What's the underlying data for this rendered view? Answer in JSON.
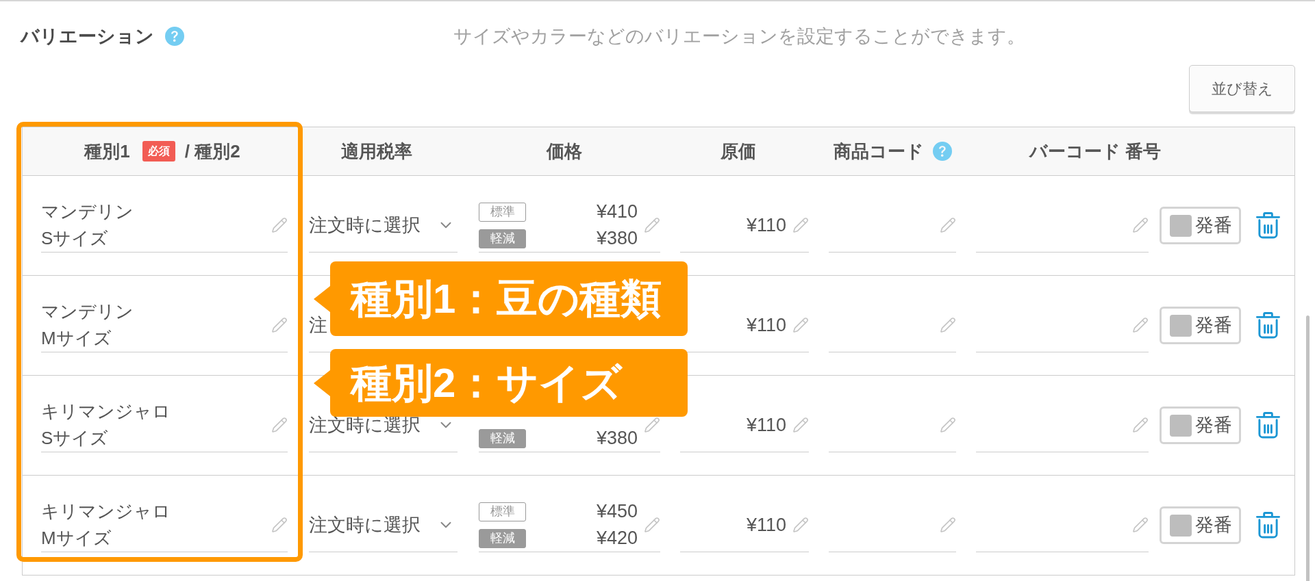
{
  "section": {
    "title": "バリエーション",
    "help": true,
    "description": "サイズやカラーなどのバリエーションを設定することができます。"
  },
  "sort_button": {
    "label": "並び替え"
  },
  "table": {
    "columns": [
      {
        "label": "種別1",
        "badge": "必須",
        "suffix": "/ 種別2"
      },
      {
        "label": "適用税率"
      },
      {
        "label": "価格"
      },
      {
        "label": "原価"
      },
      {
        "label": "商品コード",
        "help": true
      },
      {
        "label": "バーコード 番号"
      }
    ],
    "rows": [
      {
        "type1": "マンデリン",
        "type2": "Sサイズ",
        "tax": {
          "value": "注文時に選択",
          "expandable": true
        },
        "prices": [
          {
            "kind": "standard",
            "label": "標準",
            "price": "¥410"
          },
          {
            "kind": "reduced",
            "label": "軽減",
            "price": "¥380"
          }
        ],
        "cost": "¥110",
        "issue_button": {
          "label": "発番",
          "checked": false
        }
      },
      {
        "type1": "マンデリン",
        "type2": "Mサイズ",
        "tax": {
          "value": "注"
        },
        "cost": "¥110",
        "issue_button": {
          "label": "発番",
          "checked": false
        }
      },
      {
        "type1": "キリマンジャロ",
        "type2": "Sサイズ",
        "tax": {
          "value": "注文時に選択",
          "expandable": true
        },
        "prices": [
          {
            "kind": "reduced",
            "label": "軽減",
            "price": "¥380"
          }
        ],
        "cost": "¥110",
        "issue_button": {
          "label": "発番",
          "checked": false
        }
      },
      {
        "type1": "キリマンジャロ",
        "type2": "Mサイズ",
        "tax": {
          "value": "注文時に選択",
          "expandable": true
        },
        "prices": [
          {
            "kind": "standard",
            "label": "標準",
            "price": "¥450"
          },
          {
            "kind": "reduced",
            "label": "軽減",
            "price": "¥420"
          }
        ],
        "cost": "¥110",
        "issue_button": {
          "label": "発番",
          "checked": false
        }
      }
    ]
  },
  "annotations": [
    {
      "text": "種別1：豆の種類"
    },
    {
      "text": "種別2：サイズ"
    }
  ]
}
